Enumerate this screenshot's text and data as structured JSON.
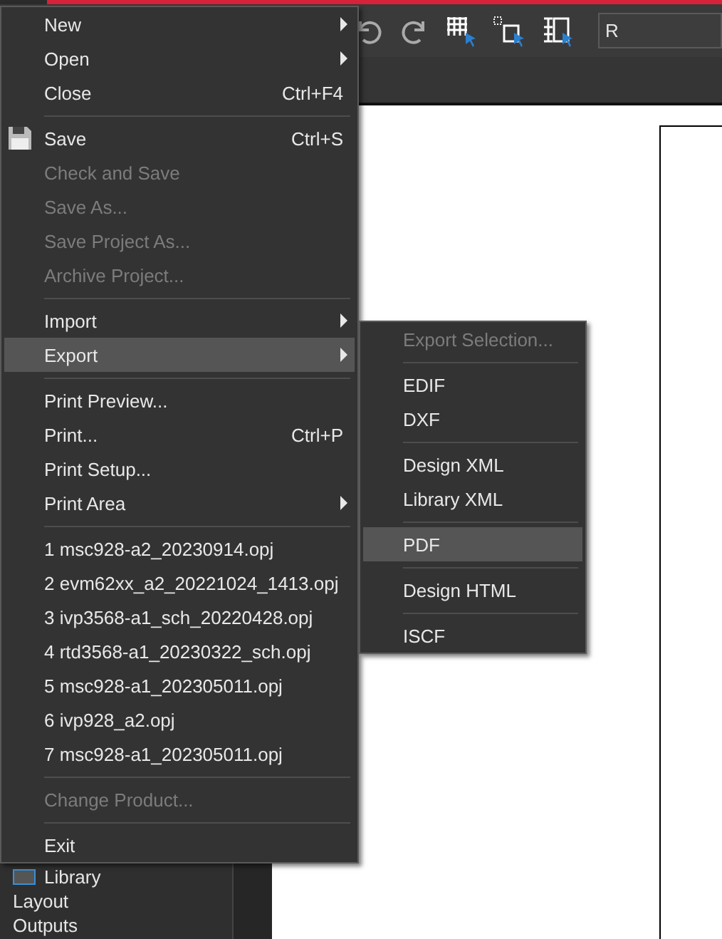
{
  "toolbar": {
    "search_field": {
      "value": "R"
    }
  },
  "panel": {
    "items": [
      {
        "label": "Library",
        "icon": true
      },
      {
        "label": "Layout",
        "icon": false
      },
      {
        "label": "Outputs",
        "icon": false
      }
    ]
  },
  "menu": {
    "items": [
      {
        "kind": "item",
        "label": "New",
        "submenu": true,
        "disabled": false,
        "selected": false,
        "icon": false
      },
      {
        "kind": "item",
        "label": "Open",
        "submenu": true,
        "disabled": false,
        "selected": false,
        "icon": false
      },
      {
        "kind": "item",
        "label": "Close",
        "shortcut": "Ctrl+F4",
        "submenu": false,
        "disabled": false,
        "selected": false,
        "icon": false
      },
      {
        "kind": "separator"
      },
      {
        "kind": "item",
        "label": "Save",
        "shortcut": "Ctrl+S",
        "submenu": false,
        "disabled": false,
        "selected": false,
        "icon": true
      },
      {
        "kind": "item",
        "label": "Check and Save",
        "submenu": false,
        "disabled": true,
        "selected": false,
        "icon": false
      },
      {
        "kind": "item",
        "label": "Save As...",
        "submenu": false,
        "disabled": true,
        "selected": false,
        "icon": false
      },
      {
        "kind": "item",
        "label": "Save Project As...",
        "submenu": false,
        "disabled": true,
        "selected": false,
        "icon": false
      },
      {
        "kind": "item",
        "label": "Archive Project...",
        "submenu": false,
        "disabled": true,
        "selected": false,
        "icon": false
      },
      {
        "kind": "separator"
      },
      {
        "kind": "item",
        "label": "Import",
        "submenu": true,
        "disabled": false,
        "selected": false,
        "icon": false
      },
      {
        "kind": "item",
        "label": "Export",
        "submenu": true,
        "disabled": false,
        "selected": true,
        "icon": false,
        "submenu_items": [
          {
            "kind": "item",
            "label": "Export Selection...",
            "disabled": true,
            "selected": false
          },
          {
            "kind": "separator"
          },
          {
            "kind": "item",
            "label": "EDIF",
            "disabled": false,
            "selected": false
          },
          {
            "kind": "item",
            "label": "DXF",
            "disabled": false,
            "selected": false
          },
          {
            "kind": "separator"
          },
          {
            "kind": "item",
            "label": "Design XML",
            "disabled": false,
            "selected": false
          },
          {
            "kind": "item",
            "label": "Library XML",
            "disabled": false,
            "selected": false
          },
          {
            "kind": "separator"
          },
          {
            "kind": "item",
            "label": "PDF",
            "disabled": false,
            "selected": true
          },
          {
            "kind": "separator"
          },
          {
            "kind": "item",
            "label": "Design HTML",
            "disabled": false,
            "selected": false
          },
          {
            "kind": "separator"
          },
          {
            "kind": "item",
            "label": "ISCF",
            "disabled": false,
            "selected": false
          }
        ]
      },
      {
        "kind": "separator"
      },
      {
        "kind": "item",
        "label": "Print Preview...",
        "submenu": false,
        "disabled": false,
        "selected": false,
        "icon": false
      },
      {
        "kind": "item",
        "label": "Print...",
        "shortcut": "Ctrl+P",
        "submenu": false,
        "disabled": false,
        "selected": false,
        "icon": false
      },
      {
        "kind": "item",
        "label": "Print Setup...",
        "submenu": false,
        "disabled": false,
        "selected": false,
        "icon": false
      },
      {
        "kind": "item",
        "label": "Print Area",
        "submenu": true,
        "disabled": false,
        "selected": false,
        "icon": false
      },
      {
        "kind": "separator"
      },
      {
        "kind": "item",
        "label": "1 msc928-a2_20230914.opj",
        "submenu": false,
        "disabled": false,
        "selected": false,
        "icon": false
      },
      {
        "kind": "item",
        "label": "2 evm62xx_a2_20221024_1413.opj",
        "submenu": false,
        "disabled": false,
        "selected": false,
        "icon": false
      },
      {
        "kind": "item",
        "label": "3 ivp3568-a1_sch_20220428.opj",
        "submenu": false,
        "disabled": false,
        "selected": false,
        "icon": false
      },
      {
        "kind": "item",
        "label": "4 rtd3568-a1_20230322_sch.opj",
        "submenu": false,
        "disabled": false,
        "selected": false,
        "icon": false
      },
      {
        "kind": "item",
        "label": "5 msc928-a1_202305011.opj",
        "submenu": false,
        "disabled": false,
        "selected": false,
        "icon": false
      },
      {
        "kind": "item",
        "label": "6 ivp928_a2.opj",
        "submenu": false,
        "disabled": false,
        "selected": false,
        "icon": false
      },
      {
        "kind": "item",
        "label": "7 msc928-a1_202305011.opj",
        "submenu": false,
        "disabled": false,
        "selected": false,
        "icon": false
      },
      {
        "kind": "separator"
      },
      {
        "kind": "item",
        "label": "Change Product...",
        "submenu": false,
        "disabled": true,
        "selected": false,
        "icon": false
      },
      {
        "kind": "separator"
      },
      {
        "kind": "item",
        "label": "Exit",
        "submenu": false,
        "disabled": false,
        "selected": false,
        "icon": false
      }
    ]
  }
}
